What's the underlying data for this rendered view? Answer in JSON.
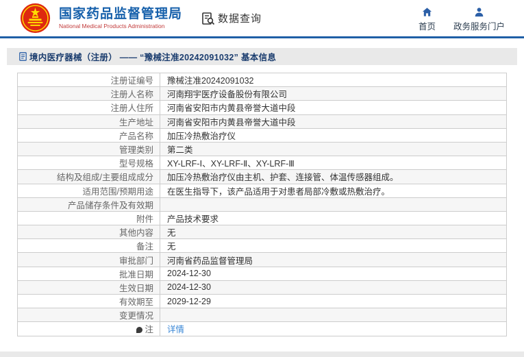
{
  "header": {
    "org_name_cn": "国家药品监督管理局",
    "org_name_en": "National Medical Products Administration",
    "data_query_label": "数据查询",
    "nav_home_label": "首页",
    "nav_portal_label": "政务服务门户"
  },
  "breadcrumb": {
    "text": "境内医疗器械（注册） —— “豫械注准20242091032” 基本信息"
  },
  "table": {
    "rows": [
      {
        "label": "注册证编号",
        "value": "豫械注准20242091032"
      },
      {
        "label": "注册人名称",
        "value": "河南翔宇医疗设备股份有限公司"
      },
      {
        "label": "注册人住所",
        "value": "河南省安阳市内黄县帝誉大道中段"
      },
      {
        "label": "生产地址",
        "value": "河南省安阳市内黄县帝誉大道中段"
      },
      {
        "label": "产品名称",
        "value": "加压冷热敷治疗仪"
      },
      {
        "label": "管理类别",
        "value": "第二类"
      },
      {
        "label": "型号规格",
        "value": "XY-LRF-Ⅰ、XY-LRF-Ⅱ、XY-LRF-Ⅲ"
      },
      {
        "label": "结构及组成/主要组成成分",
        "value": "加压冷热敷治疗仪由主机、护套、连接管、体温传感器组成。"
      },
      {
        "label": "适用范围/预期用途",
        "value": "在医生指导下，该产品适用于对患者局部冷敷或热敷治疗。"
      },
      {
        "label": "产品储存条件及有效期",
        "value": ""
      },
      {
        "label": "附件",
        "value": "产品技术要求"
      },
      {
        "label": "其他内容",
        "value": "无"
      },
      {
        "label": "备注",
        "value": "无"
      },
      {
        "label": "审批部门",
        "value": "河南省药品监督管理局"
      },
      {
        "label": "批准日期",
        "value": "2024-12-30"
      },
      {
        "label": "生效日期",
        "value": "2024-12-30"
      },
      {
        "label": "有效期至",
        "value": "2029-12-29"
      },
      {
        "label": "变更情况",
        "value": ""
      },
      {
        "label": "注",
        "value": "详情",
        "is_link": true,
        "icon": "balloon-icon"
      }
    ]
  },
  "colors": {
    "brand_blue": "#1660ab",
    "brand_red": "#c23a3a",
    "header_border_blue": "#1f5fa6",
    "nav_icon_blue": "#2b5fa7",
    "breadcrumb_bg": "#e9e9e9",
    "breadcrumb_text": "#1a3c6e",
    "table_border": "#cccccc",
    "label_text": "#666666",
    "value_text": "#333333",
    "link_blue": "#3a87d6",
    "row_alt_bg": "#f6f6f6",
    "emblem_red": "#de2910",
    "emblem_gold": "#ffde00"
  }
}
